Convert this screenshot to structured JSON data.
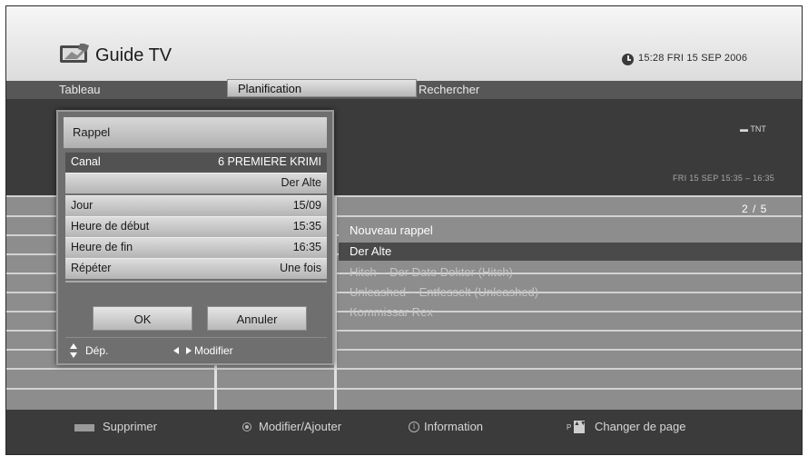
{
  "header": {
    "title": "Guide TV",
    "datetime": "15:28 FRI 15 SEP 2006"
  },
  "tabs": [
    {
      "label": "Tableau"
    },
    {
      "label": "Planification"
    },
    {
      "label": "Rechercher"
    }
  ],
  "channel_info": {
    "logo": "TNT",
    "time_range": "FRI 15 SEP 15:35 – 16:35"
  },
  "list": {
    "page": "2 / 5",
    "items": [
      {
        "label": "Nouveau rappel"
      },
      {
        "label": "Der Alte"
      },
      {
        "label": "Hitch – Der Date Doktor (Hitch)"
      },
      {
        "label": "Unleashed – Entfesselt (Unleashed)"
      },
      {
        "label": "Kommissar Rex"
      }
    ]
  },
  "dialog": {
    "title": "Rappel",
    "rows": [
      {
        "label": "Canal",
        "value": "6 PREMIERE KRIMI"
      },
      {
        "label": "",
        "value": "Der Alte"
      },
      {
        "label": "Jour",
        "value": "15/09"
      },
      {
        "label": "Heure de début",
        "value": "15:35"
      },
      {
        "label": "Heure de fin",
        "value": "16:35"
      },
      {
        "label": "Répéter",
        "value": "Une fois"
      }
    ],
    "ok_label": "OK",
    "cancel_label": "Annuler",
    "hint_move": "Dép.",
    "hint_modify": "Modifier"
  },
  "footer": {
    "delete": "Supprimer",
    "modify_add": "Modifier/Ajouter",
    "information": "Information",
    "change_page": "Changer de page",
    "info_glyph": "i",
    "page_glyph_p": "P",
    "page_glyph_arrows": "▲▼"
  },
  "colors": {
    "selected_row": "#4a4a4a",
    "header_bg": "#e8e8e8",
    "screen_bg": "#3b3b3b"
  },
  "icons": [
    "tv-logo-icon",
    "clock-icon",
    "tnt-logo-icon",
    "red-key-icon",
    "ok-key-icon",
    "info-key-icon",
    "page-key-icon",
    "updown-arrows-icon",
    "leftright-arrows-icon"
  ]
}
